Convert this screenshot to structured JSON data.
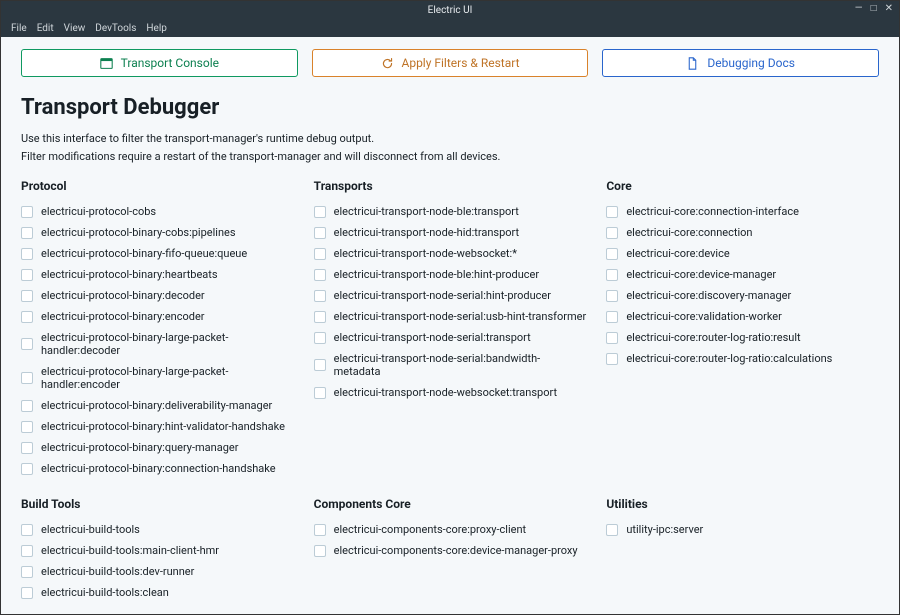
{
  "window": {
    "title": "Electric UI"
  },
  "menu": [
    "File",
    "Edit",
    "View",
    "DevTools",
    "Help"
  ],
  "buttons": {
    "console": "Transport Console",
    "apply": "Apply Filters & Restart",
    "docs": "Debugging Docs"
  },
  "header": {
    "title": "Transport Debugger",
    "line1": "Use this interface to filter the transport-manager's runtime debug output.",
    "line2": "Filter modifications require a restart of the transport-manager and will disconnect from all devices."
  },
  "sections": [
    {
      "title": "Protocol",
      "items": [
        "electricui-protocol-cobs",
        "electricui-protocol-binary-cobs:pipelines",
        "electricui-protocol-binary-fifo-queue:queue",
        "electricui-protocol-binary:heartbeats",
        "electricui-protocol-binary:decoder",
        "electricui-protocol-binary:encoder",
        "electricui-protocol-binary-large-packet-handler:decoder",
        "electricui-protocol-binary-large-packet-handler:encoder",
        "electricui-protocol-binary:deliverability-manager",
        "electricui-protocol-binary:hint-validator-handshake",
        "electricui-protocol-binary:query-manager",
        "electricui-protocol-binary:connection-handshake"
      ]
    },
    {
      "title": "Transports",
      "items": [
        "electricui-transport-node-ble:transport",
        "electricui-transport-node-hid:transport",
        "electricui-transport-node-websocket:*",
        "electricui-transport-node-ble:hint-producer",
        "electricui-transport-node-serial:hint-producer",
        "electricui-transport-node-serial:usb-hint-transformer",
        "electricui-transport-node-serial:transport",
        "electricui-transport-node-serial:bandwidth-metadata",
        "electricui-transport-node-websocket:transport"
      ]
    },
    {
      "title": "Core",
      "items": [
        "electricui-core:connection-interface",
        "electricui-core:connection",
        "electricui-core:device",
        "electricui-core:device-manager",
        "electricui-core:discovery-manager",
        "electricui-core:validation-worker",
        "electricui-core:router-log-ratio:result",
        "electricui-core:router-log-ratio:calculations"
      ]
    },
    {
      "title": "Build Tools",
      "items": [
        "electricui-build-tools",
        "electricui-build-tools:main-client-hmr",
        "electricui-build-tools:dev-runner",
        "electricui-build-tools:clean"
      ]
    },
    {
      "title": "Components Core",
      "items": [
        "electricui-components-core:proxy-client",
        "electricui-components-core:device-manager-proxy"
      ]
    },
    {
      "title": "Utilities",
      "items": [
        "utility-ipc:server"
      ]
    }
  ]
}
